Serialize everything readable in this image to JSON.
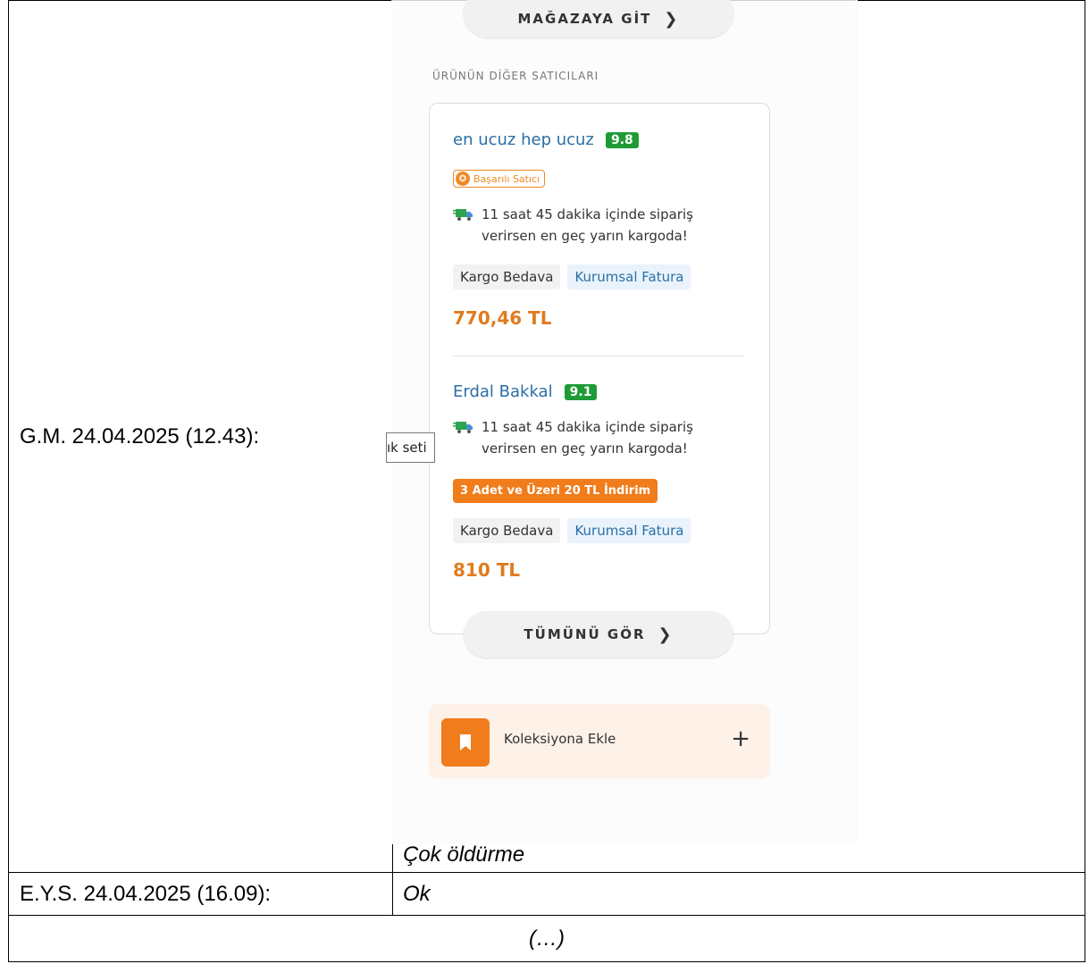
{
  "rows": [
    {
      "label": "G.M. 24.04.2025 (12.43):",
      "note": "Çok öldürme"
    },
    {
      "label": "E.Y.S. 24.04.2025 (16.09):",
      "note": "Ok"
    }
  ],
  "footer_text": "(…)",
  "screenshot": {
    "store_button": "MAĞAZAYA GİT",
    "section_title": "ÜRÜNÜN DİĞER SATICILARI",
    "sellers": [
      {
        "name": "en ucuz hep ucuz",
        "score": "9.8",
        "badge": "Başarılı Satıcı",
        "shipping_line1": "11 saat 45 dakika içinde sipariş",
        "shipping_line2": "verirsen en geç yarın kargoda!",
        "tag1": "Kargo Bedava",
        "tag2": "Kurumsal Fatura",
        "price": "770,46 TL"
      },
      {
        "name": "Erdal Bakkal",
        "score": "9.1",
        "shipping_line1": "11 saat 45 dakika içinde sipariş",
        "shipping_line2": "verirsen en geç yarın kargoda!",
        "promo": "3 Adet ve Üzeri 20 TL İndirim",
        "tag1": "Kargo Bedava",
        "tag2": "Kurumsal Fatura",
        "price": "810 TL"
      }
    ],
    "see_all_button": "TÜMÜNÜ GÖR",
    "collection_label": "Koleksiyona Ekle",
    "collection_plus": "+",
    "tooltip_text": "ık seti",
    "colors": {
      "accent_orange": "#f07c1b",
      "score_green": "#1f9b35",
      "link_blue": "#2a6fa8"
    },
    "icons": [
      "chevron-right-icon",
      "award-icon",
      "truck-icon",
      "bookmark-icon",
      "plus-icon"
    ]
  }
}
